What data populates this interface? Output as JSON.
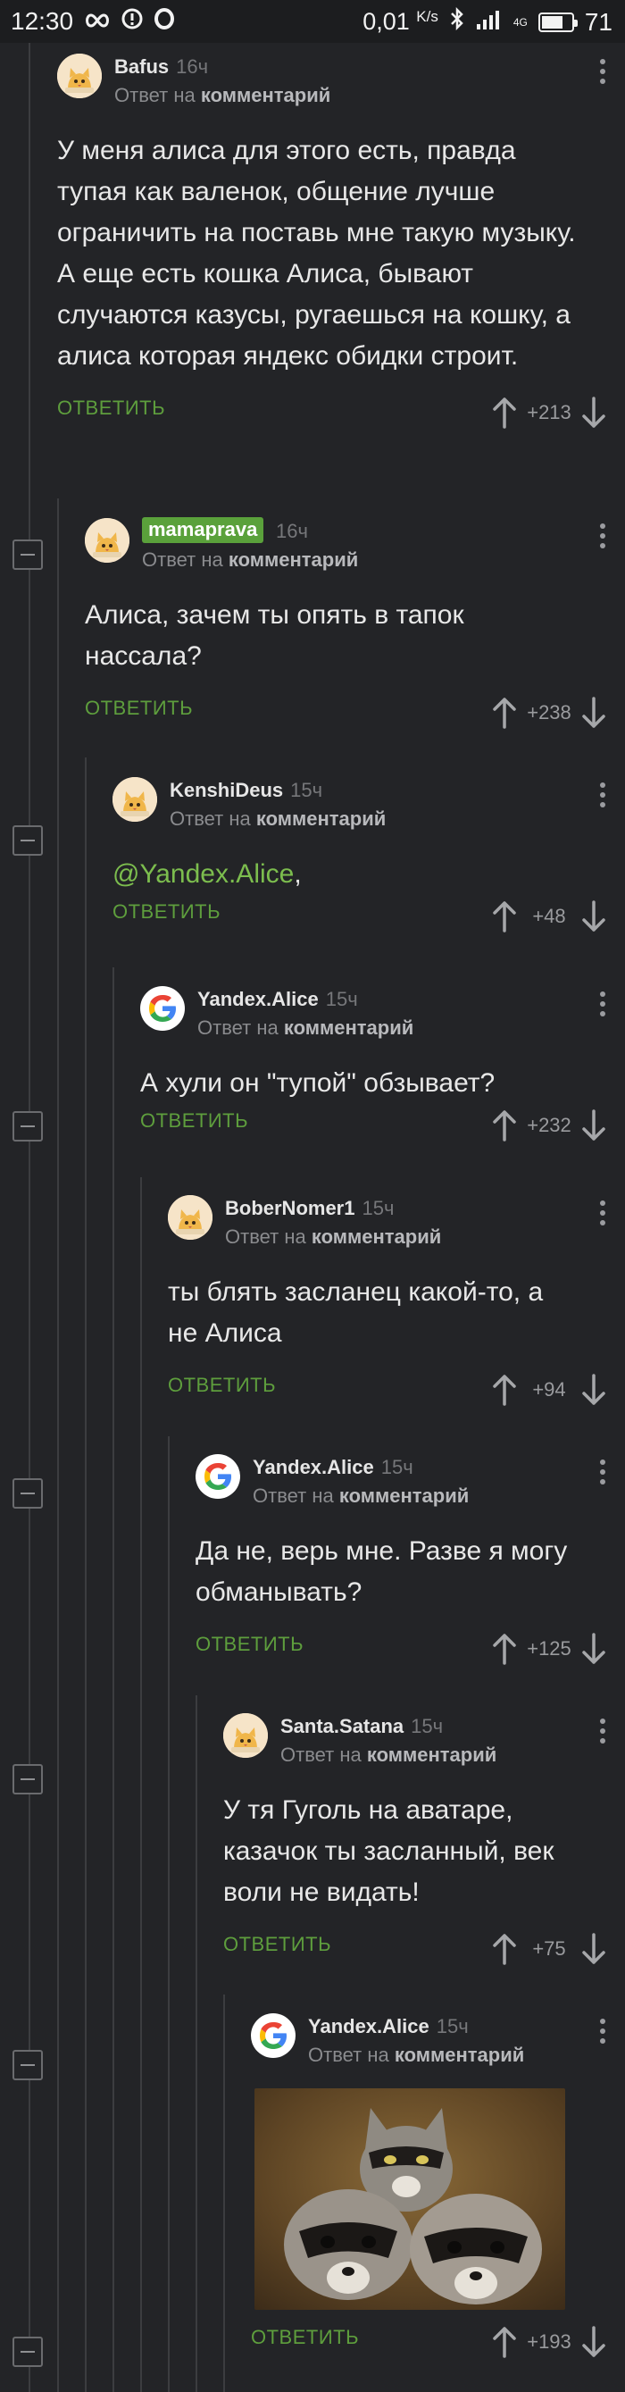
{
  "statusbar": {
    "time": "12:30",
    "speed": "0,01",
    "speed_unit": "K/s",
    "network": "4G",
    "battery": "71",
    "battery_level": 0.71
  },
  "reply_to_prefix": "Ответ на",
  "reply_to_link": "комментарий",
  "reply_label": "ОТВЕТИТЬ",
  "comments": [
    {
      "author": "Bafus",
      "time": "16ч",
      "avatar": "cat-avatar",
      "text": "У меня алиса для этого есть, правда тупая как валенок, общение лучше ограничить на поставь мне такую музыку. А еще есть кошка Алиса, бывают случаются казусы, ругаешься на кошку, а алиса которая яндекс обидки строит.",
      "score": "+213"
    },
    {
      "author": "mamaprava",
      "time": "16ч",
      "avatar": "cat-avatar",
      "text": "Алиса, зачем ты опять в тапок нассала?",
      "score": "+238"
    },
    {
      "author": "KenshiDeus",
      "time": "15ч",
      "avatar": "cat-avatar",
      "mention": "@Yandex.Alice",
      "text": ",",
      "score": "+48"
    },
    {
      "author": "Yandex.Alice",
      "time": "15ч",
      "avatar": "google-avatar",
      "text": "А хули он \"тупой\" обзывает?",
      "score": "+232"
    },
    {
      "author": "BoberNomer1",
      "time": "15ч",
      "avatar": "cat-avatar",
      "text": "ты блять засланец какой-то, а не Алиса",
      "score": "+94"
    },
    {
      "author": "Yandex.Alice",
      "time": "15ч",
      "avatar": "google-avatar",
      "text": "Да не, верь мне. Разве я могу обманывать?",
      "score": "+125"
    },
    {
      "author": "Santa.Satana",
      "time": "15ч",
      "avatar": "cat-avatar",
      "text": "У тя Гуголь на аватаре, казачок ты засланный, век воли не видать!",
      "score": "+75"
    },
    {
      "author": "Yandex.Alice",
      "time": "15ч",
      "avatar": "google-avatar",
      "image": "cat-and-raccoons-image",
      "score": "+193"
    }
  ],
  "colors": {
    "background": "#232427",
    "accent_green": "#5e9e3d",
    "mention_green": "#7cbd4e",
    "tag_green": "#5aa13b"
  }
}
